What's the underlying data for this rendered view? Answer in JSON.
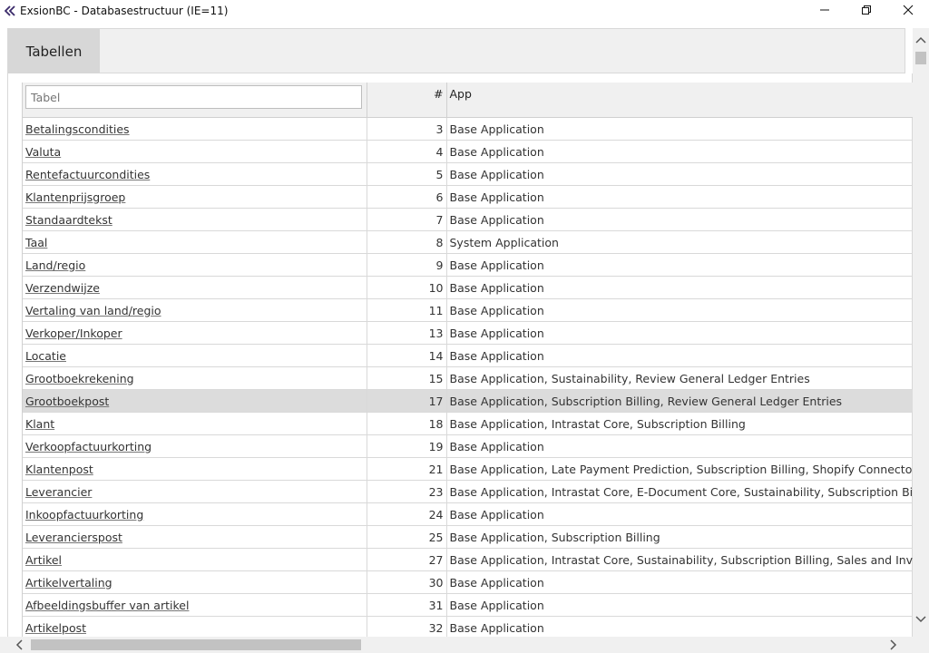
{
  "window": {
    "title": "ExsionBC - Databasestructuur (IE=11)",
    "icon": "double-chevron-left-icon"
  },
  "tabs": [
    {
      "label": "Tabellen",
      "active": true
    }
  ],
  "table": {
    "filter_placeholder": "Tabel",
    "headers": {
      "name": "Tabel",
      "number": "#",
      "app": "App"
    },
    "rows": [
      {
        "name": "Betalingscondities",
        "number": "3",
        "app": "Base Application"
      },
      {
        "name": "Valuta",
        "number": "4",
        "app": "Base Application"
      },
      {
        "name": "Rentefactuurcondities",
        "number": "5",
        "app": "Base Application"
      },
      {
        "name": "Klantenprijsgroep",
        "number": "6",
        "app": "Base Application"
      },
      {
        "name": "Standaardtekst",
        "number": "7",
        "app": "Base Application"
      },
      {
        "name": "Taal",
        "number": "8",
        "app": "System Application"
      },
      {
        "name": "Land/regio",
        "number": "9",
        "app": "Base Application"
      },
      {
        "name": "Verzendwijze",
        "number": "10",
        "app": "Base Application"
      },
      {
        "name": "Vertaling van land/regio",
        "number": "11",
        "app": "Base Application"
      },
      {
        "name": "Verkoper/Inkoper",
        "number": "13",
        "app": "Base Application"
      },
      {
        "name": "Locatie",
        "number": "14",
        "app": "Base Application"
      },
      {
        "name": "Grootboekrekening",
        "number": "15",
        "app": "Base Application, Sustainability, Review General Ledger Entries"
      },
      {
        "name": "Grootboekpost",
        "number": "17",
        "app": "Base Application, Subscription Billing, Review General Ledger Entries",
        "selected": true
      },
      {
        "name": "Klant",
        "number": "18",
        "app": "Base Application, Intrastat Core, Subscription Billing"
      },
      {
        "name": "Verkoopfactuurkorting",
        "number": "19",
        "app": "Base Application"
      },
      {
        "name": "Klantenpost",
        "number": "21",
        "app": "Base Application, Late Payment Prediction, Subscription Billing, Shopify Connector"
      },
      {
        "name": "Leverancier",
        "number": "23",
        "app": "Base Application, Intrastat Core, E-Document Core, Sustainability, Subscription Billing"
      },
      {
        "name": "Inkoopfactuurkorting",
        "number": "24",
        "app": "Base Application"
      },
      {
        "name": "Leverancierspost",
        "number": "25",
        "app": "Base Application, Subscription Billing"
      },
      {
        "name": "Artikel",
        "number": "27",
        "app": "Base Application, Intrastat Core, Sustainability, Subscription Billing, Sales and Inventor"
      },
      {
        "name": "Artikelvertaling",
        "number": "30",
        "app": "Base Application"
      },
      {
        "name": "Afbeeldingsbuffer van artikel",
        "number": "31",
        "app": "Base Application"
      },
      {
        "name": "Artikelpost",
        "number": "32",
        "app": "Base Application"
      },
      {
        "name": "",
        "number": "",
        "app": ""
      }
    ]
  },
  "colors": {
    "selected_row": "#dcdcdc",
    "tab_active": "#d7d7d7",
    "panel_bg": "#f0f0f0"
  }
}
